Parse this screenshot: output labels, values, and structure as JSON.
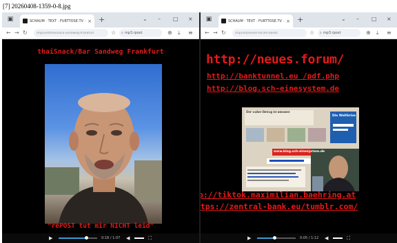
{
  "caption": "[7] 20260408-1359-0-8.jpg",
  "left": {
    "tab_title": "SCHAUM · TEXT · FURTTOSE.TV · X",
    "url": "/mp/vid/thaisnack-sandweg-frankfurt",
    "search_label": "mp3.rpost",
    "title": "thaiSnack/Bar Sandweg Frankfurt",
    "footer": "\"rePOST tut mir NICHT leid\"",
    "time": "0:18 / 1:07",
    "progress": 0.72,
    "volume": 0.8
  },
  "right": {
    "tab_title": "SCHAUM · TEXT · FURTTOSE.TV · X",
    "url": "/mp/vid/neues-forum-bankt",
    "search_label": "mp3.rpost",
    "big_url": "http://neues.forum/",
    "link1": "http://banktunnel.eu /pdf.php",
    "link2": "http://blog.sch-einesystem.de",
    "link3": "http://tiktok.maximilian.baehring.at",
    "link4": "https://zentral-bank.eu/tumblr.com/",
    "thumb_headline": "Der wahre Betrag ist umsonst",
    "thumb_box": "Die Weltkrise",
    "thumb_banner": "www.blog.sch-einesystem.de",
    "time": "0:05 / 1:12",
    "progress": 0.45,
    "volume": 0.8
  },
  "icons": {
    "back": "←",
    "forward": "→",
    "reload": "↻",
    "plus": "+",
    "close": "×",
    "minimize": "–",
    "maximize": "□",
    "play": "▶",
    "volume": "◀",
    "fullscreen": "⛶",
    "chevron": "⌄",
    "star": "☆",
    "search": "⌕"
  },
  "colors": {
    "accent_red": "#e11a1a",
    "progress_blue": "#3a9ad9"
  }
}
